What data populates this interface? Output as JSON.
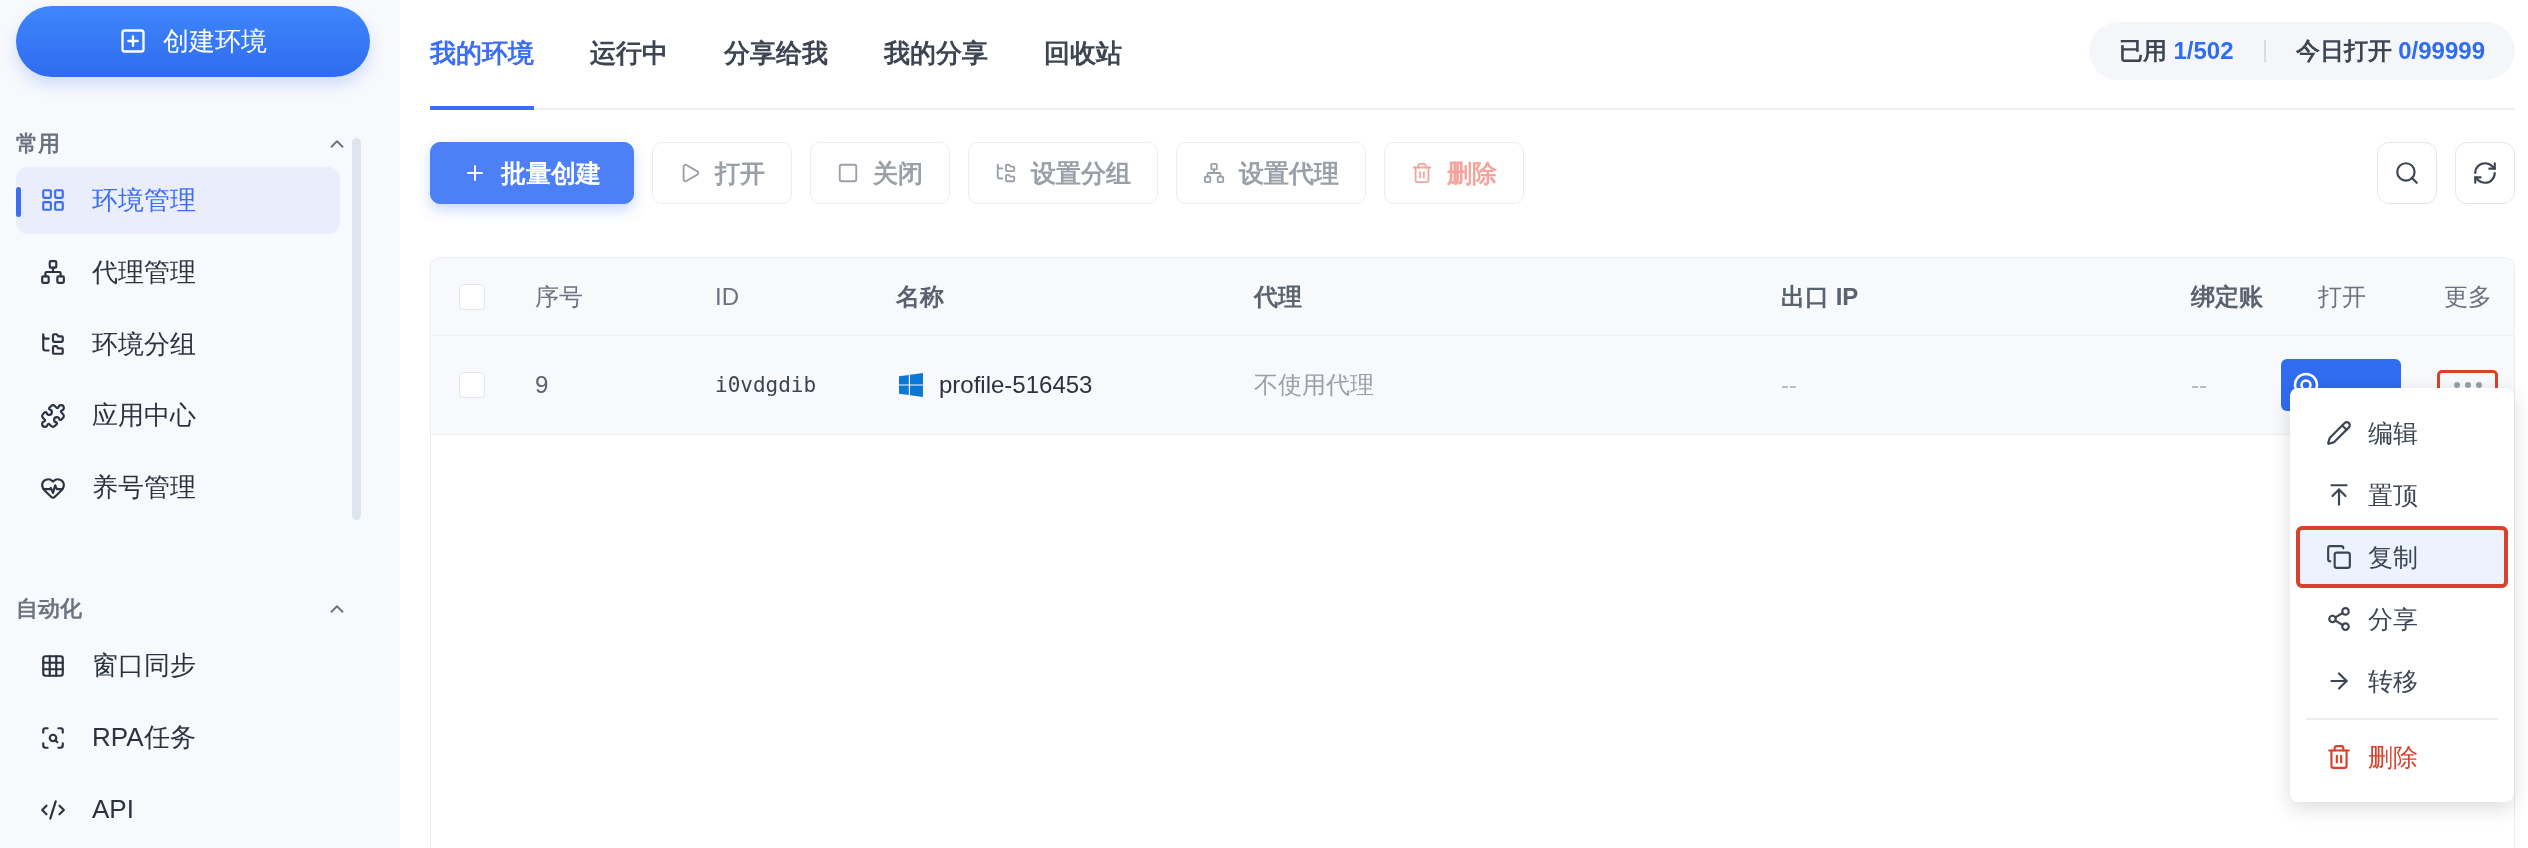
{
  "sidebar": {
    "create_button": "创建环境",
    "sections": [
      {
        "title": "常用",
        "expanded": true,
        "items": [
          {
            "label": "环境管理",
            "selected": true
          },
          {
            "label": "代理管理",
            "selected": false
          },
          {
            "label": "环境分组",
            "selected": false
          },
          {
            "label": "应用中心",
            "selected": false
          },
          {
            "label": "养号管理",
            "selected": false
          }
        ]
      },
      {
        "title": "自动化",
        "expanded": true,
        "items": [
          {
            "label": "窗口同步",
            "selected": false
          },
          {
            "label": "RPA任务",
            "selected": false
          },
          {
            "label": "API",
            "selected": false
          }
        ]
      }
    ]
  },
  "tabs": [
    {
      "label": "我的环境",
      "selected": true
    },
    {
      "label": "运行中",
      "selected": false
    },
    {
      "label": "分享给我",
      "selected": false
    },
    {
      "label": "我的分享",
      "selected": false
    },
    {
      "label": "回收站",
      "selected": false
    }
  ],
  "usage": [
    {
      "label": "已用",
      "value": "1/502"
    },
    {
      "label": "今日打开",
      "value": "0/99999"
    }
  ],
  "toolbar": [
    {
      "label": "批量创建",
      "kind": "primary",
      "disabled": false
    },
    {
      "label": "打开",
      "kind": "default",
      "disabled": true
    },
    {
      "label": "关闭",
      "kind": "default",
      "disabled": true
    },
    {
      "label": "设置分组",
      "kind": "default",
      "disabled": true
    },
    {
      "label": "设置代理",
      "kind": "default",
      "disabled": true
    },
    {
      "label": "删除",
      "kind": "danger",
      "disabled": true
    }
  ],
  "table": {
    "header_checked": false,
    "columns": [
      "序号",
      "ID",
      "名称",
      "代理",
      "出口 IP",
      "绑定账",
      "打开",
      "更多"
    ],
    "rows": [
      {
        "checked": false,
        "index": "9",
        "id": "i0vdgdib",
        "name": "profile-516453",
        "proxy": "不使用代理",
        "exit_ip": "--",
        "account": "--",
        "more_highlighted": true
      }
    ]
  },
  "menu": [
    {
      "label": "编辑",
      "kind": "normal",
      "highlighted": false
    },
    {
      "label": "置顶",
      "kind": "normal",
      "highlighted": false
    },
    {
      "label": "复制",
      "kind": "normal",
      "highlighted": true
    },
    {
      "label": "分享",
      "kind": "normal",
      "highlighted": false
    },
    {
      "label": "转移",
      "kind": "normal",
      "highlighted": false
    },
    {
      "label": "删除",
      "kind": "danger",
      "highlighted": false
    }
  ]
}
